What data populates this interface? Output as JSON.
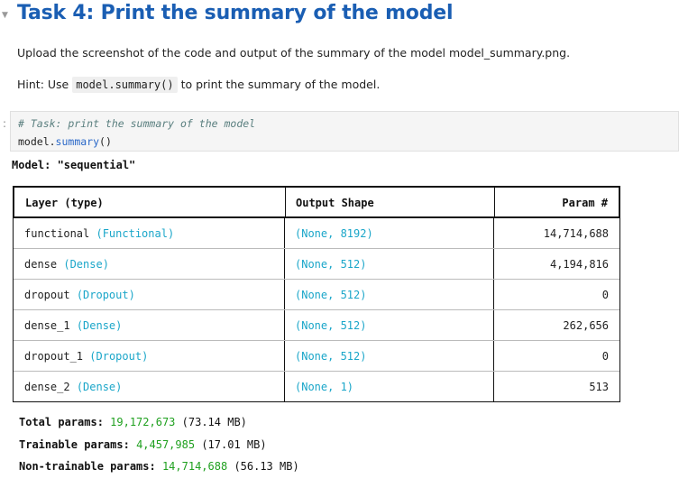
{
  "heading": "Task 4: Print the summary of the model",
  "instructions": {
    "upload_text": "Upload the screenshot of the code and output of the summary of the model model_summary.png.",
    "hint_prefix": "Hint: Use",
    "hint_code": "model.summary()",
    "hint_suffix": "to print the summary of the model."
  },
  "cell": {
    "prompt": ":",
    "comment": "# Task: print the summary of the model",
    "code_obj": "model.",
    "code_fn": "summary",
    "code_args": "()"
  },
  "model_line": "Model: \"sequential\"",
  "table": {
    "headers": [
      "Layer (type)",
      "Output Shape",
      "Param #"
    ],
    "rows": [
      {
        "name": "functional",
        "type": "(Functional)",
        "shape_none": "(None,",
        "shape_dim": " 8192)",
        "params": "14,714,688"
      },
      {
        "name": "dense",
        "type": "(Dense)",
        "shape_none": "(None,",
        "shape_dim": " 512)",
        "params": "4,194,816"
      },
      {
        "name": "dropout",
        "type": "(Dropout)",
        "shape_none": "(None,",
        "shape_dim": " 512)",
        "params": "0"
      },
      {
        "name": "dense_1",
        "type": "(Dense)",
        "shape_none": "(None,",
        "shape_dim": " 512)",
        "params": "262,656"
      },
      {
        "name": "dropout_1",
        "type": "(Dropout)",
        "shape_none": "(None,",
        "shape_dim": " 512)",
        "params": "0"
      },
      {
        "name": "dense_2",
        "type": "(Dense)",
        "shape_none": "(None,",
        "shape_dim": " 1)",
        "params": "513"
      }
    ]
  },
  "totals": {
    "total_label": "Total params:",
    "total_value": "19,172,673",
    "total_size": "(73.14 MB)",
    "trainable_label": "Trainable params:",
    "trainable_value": "4,457,985",
    "trainable_size": "(17.01 MB)",
    "nontrainable_label": "Non-trainable params:",
    "nontrainable_value": "14,714,688",
    "nontrainable_size": "(56.13 MB)"
  },
  "colors": {
    "heading": "#1a5eb3",
    "type_cyan": "#1aa6c9",
    "param_green": "#1fa01f"
  }
}
